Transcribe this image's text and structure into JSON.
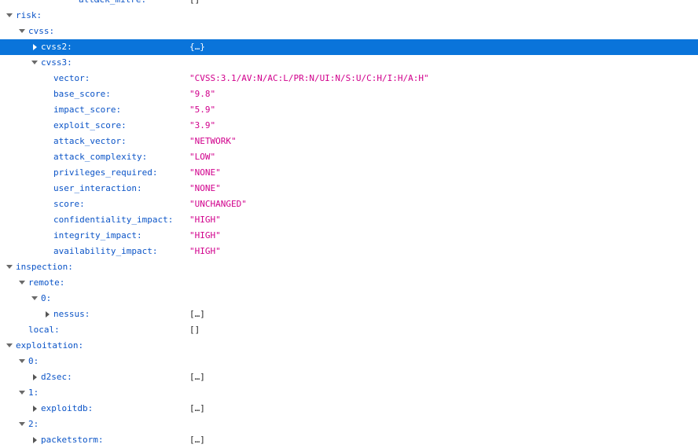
{
  "rows": [
    {
      "key": "att&ck_mitre:",
      "value": "[]",
      "type": "obj",
      "depth": 3,
      "toggle": "none"
    },
    {
      "key": "risk:",
      "value": "",
      "type": "obj",
      "depth": 0,
      "toggle": "open"
    },
    {
      "key": "cvss:",
      "value": "",
      "type": "obj",
      "depth": 1,
      "toggle": "open"
    },
    {
      "key": "cvss2:",
      "value": "{…}",
      "type": "obj",
      "depth": 2,
      "toggle": "closed",
      "selected": true
    },
    {
      "key": "cvss3:",
      "value": "",
      "type": "obj",
      "depth": 2,
      "toggle": "open"
    },
    {
      "key": "vector:",
      "value": "\"CVSS:3.1/AV:N/AC:L/PR:N/UI:N/S:U/C:H/I:H/A:H\"",
      "type": "str",
      "depth": 3,
      "toggle": "none"
    },
    {
      "key": "base_score:",
      "value": "\"9.8\"",
      "type": "str",
      "depth": 3,
      "toggle": "none"
    },
    {
      "key": "impact_score:",
      "value": "\"5.9\"",
      "type": "str",
      "depth": 3,
      "toggle": "none"
    },
    {
      "key": "exploit_score:",
      "value": "\"3.9\"",
      "type": "str",
      "depth": 3,
      "toggle": "none"
    },
    {
      "key": "attack_vector:",
      "value": "\"NETWORK\"",
      "type": "str",
      "depth": 3,
      "toggle": "none"
    },
    {
      "key": "attack_complexity:",
      "value": "\"LOW\"",
      "type": "str",
      "depth": 3,
      "toggle": "none"
    },
    {
      "key": "privileges_required:",
      "value": "\"NONE\"",
      "type": "str",
      "depth": 3,
      "toggle": "none"
    },
    {
      "key": "user_interaction:",
      "value": "\"NONE\"",
      "type": "str",
      "depth": 3,
      "toggle": "none"
    },
    {
      "key": "score:",
      "value": "\"UNCHANGED\"",
      "type": "str",
      "depth": 3,
      "toggle": "none"
    },
    {
      "key": "confidentiality_impact:",
      "value": "\"HIGH\"",
      "type": "str",
      "depth": 3,
      "toggle": "none"
    },
    {
      "key": "integrity_impact:",
      "value": "\"HIGH\"",
      "type": "str",
      "depth": 3,
      "toggle": "none"
    },
    {
      "key": "availability_impact:",
      "value": "\"HIGH\"",
      "type": "str",
      "depth": 3,
      "toggle": "none"
    },
    {
      "key": "inspection:",
      "value": "",
      "type": "obj",
      "depth": 0,
      "toggle": "open"
    },
    {
      "key": "remote:",
      "value": "",
      "type": "obj",
      "depth": 1,
      "toggle": "open"
    },
    {
      "key": "0:",
      "value": "",
      "type": "obj",
      "depth": 2,
      "toggle": "open"
    },
    {
      "key": "nessus:",
      "value": "[…]",
      "type": "obj",
      "depth": 3,
      "toggle": "closed"
    },
    {
      "key": "local:",
      "value": "[]",
      "type": "obj",
      "depth": 1,
      "toggle": "none"
    },
    {
      "key": "exploitation:",
      "value": "",
      "type": "obj",
      "depth": 0,
      "toggle": "open"
    },
    {
      "key": "0:",
      "value": "",
      "type": "obj",
      "depth": 1,
      "toggle": "open"
    },
    {
      "key": "d2sec:",
      "value": "[…]",
      "type": "obj",
      "depth": 2,
      "toggle": "closed"
    },
    {
      "key": "1:",
      "value": "",
      "type": "obj",
      "depth": 1,
      "toggle": "open"
    },
    {
      "key": "exploitdb:",
      "value": "[…]",
      "type": "obj",
      "depth": 2,
      "toggle": "closed"
    },
    {
      "key": "2:",
      "value": "",
      "type": "obj",
      "depth": 1,
      "toggle": "open"
    },
    {
      "key": "packetstorm:",
      "value": "[…]",
      "type": "obj",
      "depth": 2,
      "toggle": "closed"
    }
  ]
}
